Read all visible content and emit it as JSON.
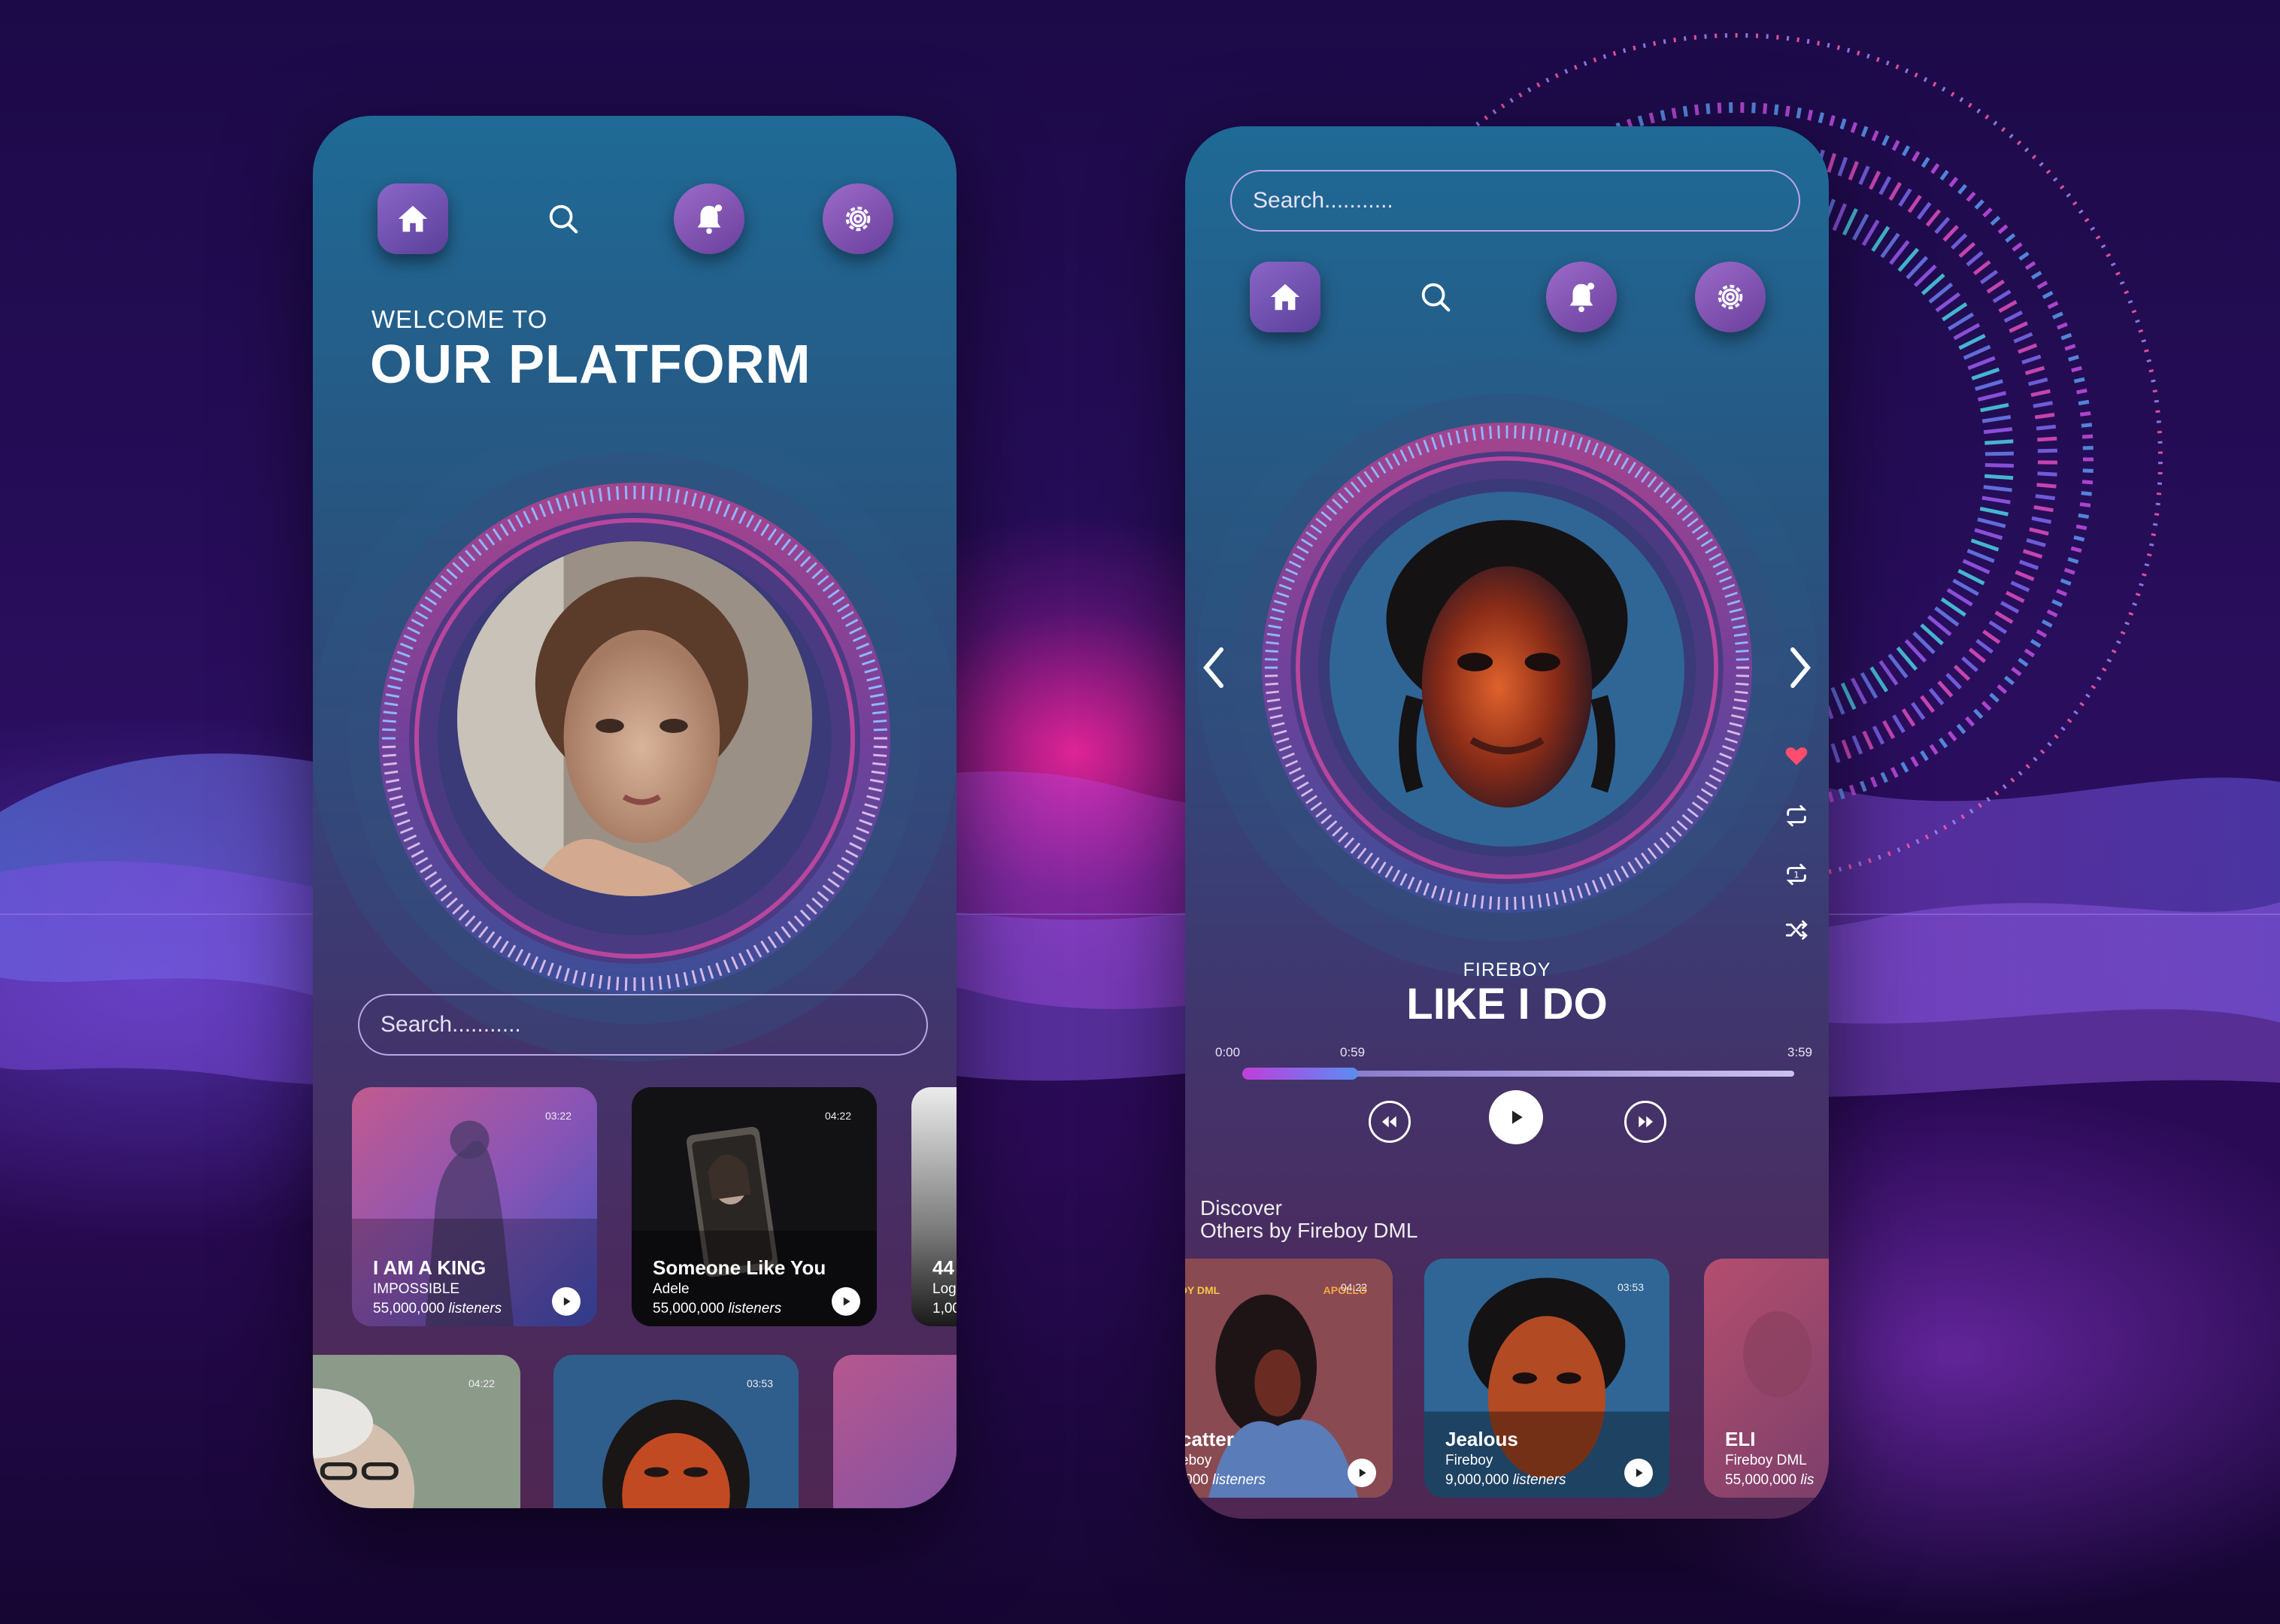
{
  "phone1": {
    "nav": [
      {
        "icon": "home-icon"
      },
      {
        "icon": "search-icon"
      },
      {
        "icon": "bell-icon"
      },
      {
        "icon": "gear-icon"
      }
    ],
    "welcome_small": "WELCOME TO",
    "welcome_big": "OUR PLATFORM",
    "search_placeholder": "Search...........",
    "cards_row1": [
      {
        "duration": "03:22",
        "title": "I AM A KING",
        "subtitle": "IMPOSSIBLE",
        "listeners": "55,000,000",
        "listeners_label": "listeners"
      },
      {
        "duration": "04:22",
        "title": "Someone Like You",
        "subtitle": "Adele",
        "listeners": "55,000,000",
        "listeners_label": "listeners"
      },
      {
        "duration": "",
        "title": "44",
        "subtitle": "Log",
        "listeners": "1,00",
        "listeners_label": ""
      }
    ],
    "cards_row2": [
      {
        "duration": "04:22"
      },
      {
        "duration": "03:53"
      },
      {
        "duration": ""
      }
    ]
  },
  "phone2": {
    "search_placeholder": "Search...........",
    "nav": [
      {
        "icon": "home-icon"
      },
      {
        "icon": "search-icon"
      },
      {
        "icon": "bell-icon"
      },
      {
        "icon": "gear-icon"
      }
    ],
    "artist": "FIREBOY",
    "song": "LIKE I DO",
    "time_start": "0:00",
    "time_current": "0:59",
    "time_end": "3:59",
    "progress": 0.21,
    "discover_title": "Discover",
    "discover_sub": "Others by Fireboy DML",
    "cards": [
      {
        "duration": "04:22",
        "badge": "OY DML",
        "badge2": "APOLLO",
        "title": "catter",
        "subtitle": "eboy",
        "listeners": ",000",
        "listeners_label": "listeners"
      },
      {
        "duration": "03:53",
        "title": "Jealous",
        "subtitle": "Fireboy",
        "listeners": "9,000,000",
        "listeners_label": "listeners"
      },
      {
        "duration": "",
        "title": "ELI",
        "subtitle": "Fireboy DML",
        "listeners": "55,000,000",
        "listeners_label": "lis"
      }
    ],
    "side_icons": [
      "heart-icon",
      "repeat-icon",
      "repeat-one-icon",
      "shuffle-icon"
    ],
    "heart_color": "#ff4d6d"
  },
  "colors": {
    "accent_pink": "#e0359b",
    "accent_blue": "#5a8cf2",
    "nav_active": "#7a55b8"
  }
}
